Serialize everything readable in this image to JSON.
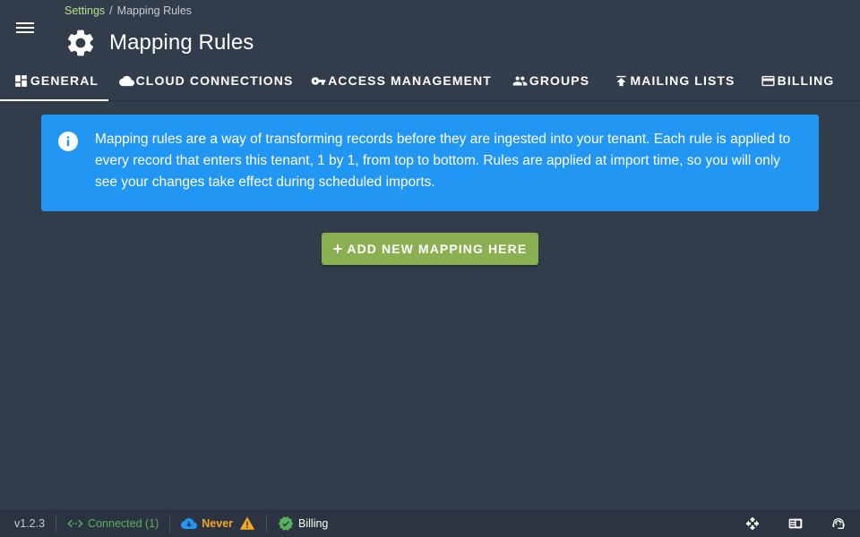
{
  "header": {
    "breadcrumb": {
      "parent": "Settings",
      "separator": "/",
      "current": "Mapping Rules"
    },
    "title": "Mapping Rules",
    "title_icon": "gear-icon",
    "menu_icon": "hamburger-menu-icon"
  },
  "tabs": [
    {
      "label": "GENERAL",
      "icon": "dashboard-icon",
      "active": true
    },
    {
      "label": "CLOUD CONNECTIONS",
      "icon": "cloud-icon",
      "active": false
    },
    {
      "label": "ACCESS MANAGEMENT",
      "icon": "key-icon",
      "active": false
    },
    {
      "label": "GROUPS",
      "icon": "people-icon",
      "active": false
    },
    {
      "label": "MAILING LISTS",
      "icon": "upload-icon",
      "active": false
    },
    {
      "label": "BILLING",
      "icon": "credit-card-icon",
      "active": false
    }
  ],
  "alert": {
    "icon": "info-icon",
    "text": "Mapping rules are a way of transforming records before they are ingested into your tenant. Each rule is applied to every record that enters this tenant, 1 by 1, from top to bottom. Rules are applied at import time, so you will only see your changes take effect during scheduled imports."
  },
  "add_button": {
    "label": "ADD NEW MAPPING HERE",
    "icon": "plus-icon"
  },
  "status_bar": {
    "version": "v1.2.3",
    "connection": {
      "icon": "connection-arrows-icon",
      "label": "Connected (1)"
    },
    "sync": {
      "icon": "cloud-download-icon",
      "label": "Never",
      "warning_icon": "warning-icon"
    },
    "billing": {
      "icon": "verified-badge-icon",
      "label": "Billing"
    },
    "right_icons": [
      "move-icon",
      "news-icon",
      "support-agent-icon"
    ]
  },
  "colors": {
    "background": "#323d4c",
    "alert": "#2196f3",
    "button": "#8bb052",
    "connected": "#57b35b",
    "warning": "#f5a623",
    "breadcrumb_link": "#b7e08a"
  }
}
